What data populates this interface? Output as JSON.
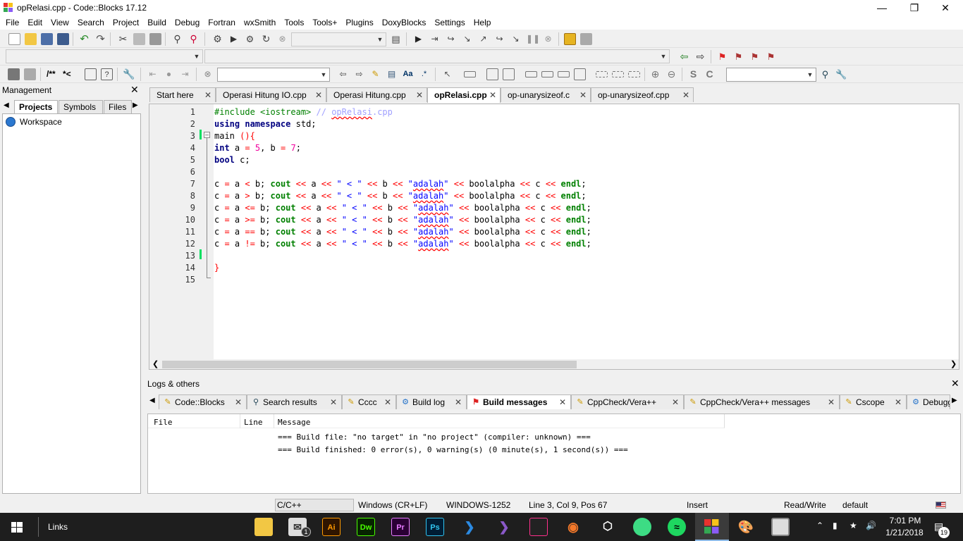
{
  "window": {
    "title": "opRelasi.cpp - Code::Blocks 17.12"
  },
  "menu": [
    "File",
    "Edit",
    "View",
    "Search",
    "Project",
    "Build",
    "Debug",
    "Fortran",
    "wxSmith",
    "Tools",
    "Tools+",
    "Plugins",
    "DoxyBlocks",
    "Settings",
    "Help"
  ],
  "toolbar3": {
    "comment_label": "/**",
    "doxy_label": "*<"
  },
  "management": {
    "title": "Management",
    "tabs": [
      "Projects",
      "Symbols",
      "Files"
    ],
    "workspace": "Workspace"
  },
  "editor_tabs": [
    "Start here",
    "Operasi Hitung IO.cpp",
    "Operasi Hitung.cpp",
    "opRelasi.cpp",
    "op-unarysizeof.c",
    "op-unarysizeof.cpp"
  ],
  "code_lines": [
    "#include <iostream> // opRelasi.cpp",
    "using namespace std;",
    "main (){",
    "int a = 5, b = 7;",
    "bool c;",
    "",
    "c = a < b; cout << a << \" < \" << b << \"adalah\" << boolalpha << c << endl;",
    "c = a > b; cout << a << \" < \" << b << \"adalah\" << boolalpha << c << endl;",
    "c = a <= b; cout << a << \" < \" << b << \"adalah\" << boolalpha << c << endl;",
    "c = a >= b; cout << a << \" < \" << b << \"adalah\" << boolalpha << c << endl;",
    "c = a == b; cout << a << \" < \" << b << \"adalah\" << boolalpha << c << endl;",
    "c = a != b; cout << a << \" < \" << b << \"adalah\" << boolalpha << c << endl;",
    "",
    "}",
    ""
  ],
  "logs": {
    "title": "Logs & others",
    "tabs": [
      "Code::Blocks",
      "Search results",
      "Cccc",
      "Build log",
      "Build messages",
      "CppCheck/Vera++",
      "CppCheck/Vera++ messages",
      "Cscope",
      "Debugge"
    ],
    "columns": [
      "File",
      "Line",
      "Message"
    ],
    "messages": [
      "=== Build file: \"no target\" in \"no project\" (compiler: unknown) ===",
      "=== Build finished: 0 error(s), 0 warning(s) (0 minute(s), 1 second(s)) ==="
    ]
  },
  "status": {
    "language": "C/C++",
    "line_endings": "Windows (CR+LF)",
    "encoding": "WINDOWS-1252",
    "position": "Line 3, Col 9, Pos 67",
    "mode": "Insert",
    "access": "Read/Write",
    "profile": "default"
  },
  "taskbar": {
    "links_label": "Links",
    "time": "7:01 PM",
    "date": "1/21/2018",
    "notif_count": "19",
    "mail_badge": "1",
    "apps": [
      "Ai",
      "Dw",
      "Pr",
      "Ps"
    ]
  }
}
